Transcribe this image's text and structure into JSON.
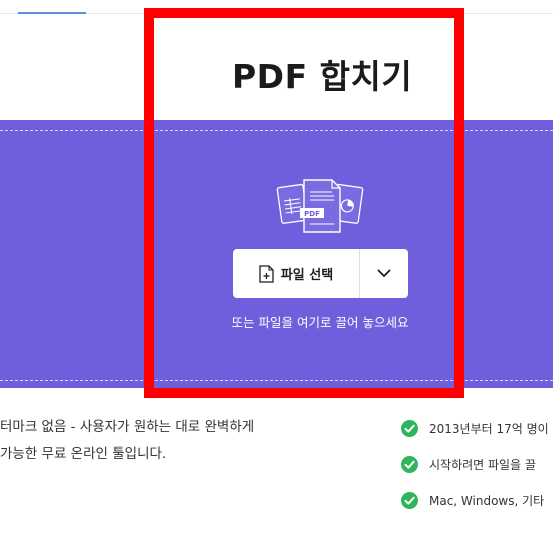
{
  "page": {
    "title": "PDF 합치기"
  },
  "dropzone": {
    "select_button_label": "파일 선택",
    "hint": "또는 파일을 여기로 끌어 놓으세요",
    "icons": {
      "files": "pdf-files-icon",
      "add_file": "file-add-icon",
      "dropdown": "chevron-down-icon"
    }
  },
  "description": {
    "line1": "터마크 없음 - 사용자가 원하는 대로 완벽하게",
    "line2": "가능한 무료 온라인 툴입니다."
  },
  "features": [
    {
      "text": "2013년부터 17억 명이"
    },
    {
      "text": "시작하려면 파일을 끌"
    },
    {
      "text": "Mac, Windows, 기타 "
    }
  ],
  "colors": {
    "dropzone_bg": "#6f5fdc",
    "check_green": "#2fb55d",
    "highlight": "#ff0000"
  }
}
